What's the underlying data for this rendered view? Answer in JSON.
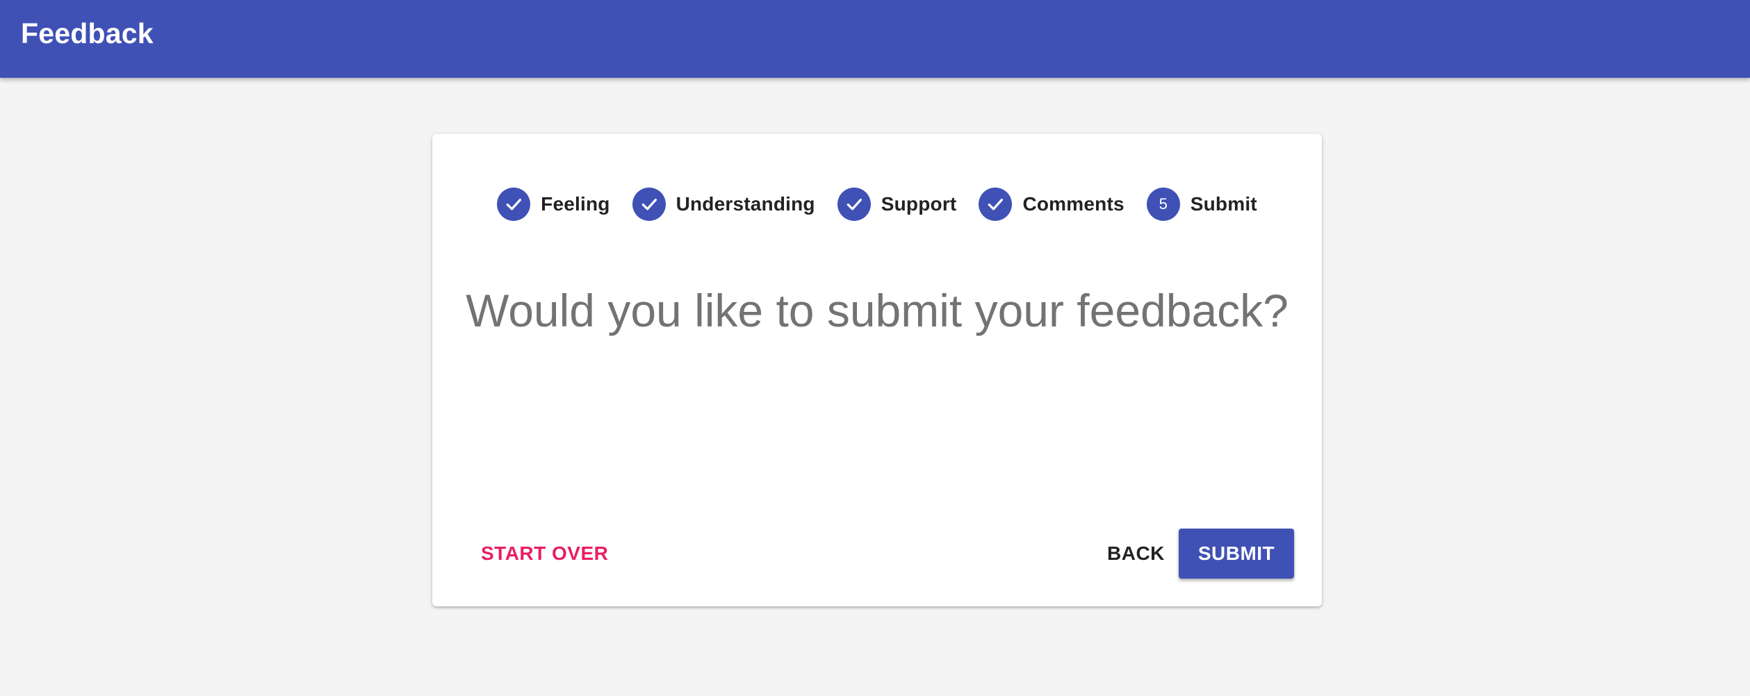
{
  "app_bar": {
    "title": "Feedback",
    "background_color": "#3f51b5"
  },
  "stepper": {
    "steps": [
      {
        "label": "Feeling",
        "state": "completed",
        "icon": "check-icon"
      },
      {
        "label": "Understanding",
        "state": "completed",
        "icon": "check-icon"
      },
      {
        "label": "Support",
        "state": "completed",
        "icon": "check-icon"
      },
      {
        "label": "Comments",
        "state": "completed",
        "icon": "check-icon"
      },
      {
        "label": "Submit",
        "state": "active",
        "number": "5"
      }
    ],
    "accent_color": "#3f51b5"
  },
  "main": {
    "prompt": "Would you like to submit your feedback?"
  },
  "actions": {
    "start_over_label": "START OVER",
    "back_label": "BACK",
    "submit_label": "SUBMIT",
    "start_over_color": "#e91e63"
  }
}
